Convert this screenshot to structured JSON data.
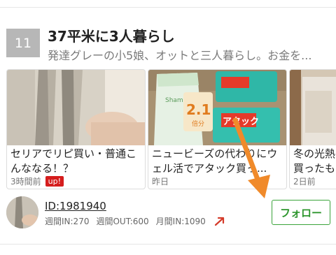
{
  "entry": {
    "rank": "11",
    "title": "37平米に3人暮らし",
    "description": "発達グレーの小5娘、オットと三人暮らし。お金を..."
  },
  "cards": [
    {
      "title": "セリアでリピ買い・普通こんななる！？",
      "time": "3時間前",
      "badge": "up!"
    },
    {
      "title": "ニュービーズの代わりにウェル活でアタック買っ...",
      "time": "昨日"
    },
    {
      "title": "冬の光熱買ったも",
      "time": "2日前"
    }
  ],
  "product_labels": {
    "refill_bag": "Shampoo",
    "refill_bag_number": "2.1",
    "refill_bag_unit": "倍分",
    "detergent_brand": "アタック"
  },
  "blogger": {
    "id": "ID:1981940",
    "weekly_in": "週間IN:270",
    "weekly_out": "週間OUT:600",
    "monthly_in": "月間IN:1090",
    "follow_label": "フォロー"
  },
  "colors": {
    "follow_green": "#3aa33a",
    "badge_red": "#d51d1d",
    "annotation_orange": "#f08a2a",
    "trend_red": "#d43b2a"
  }
}
